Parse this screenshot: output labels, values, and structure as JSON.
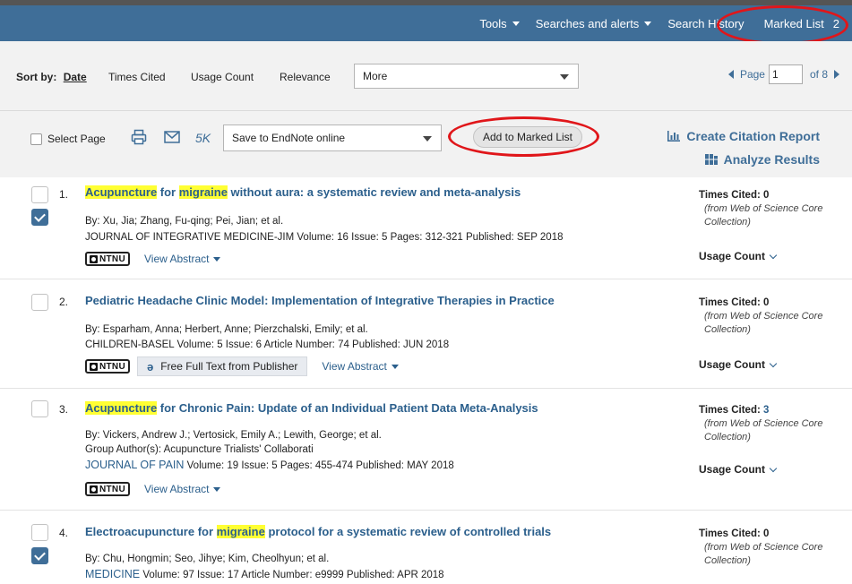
{
  "topnav": {
    "tools": "Tools",
    "searches": "Searches and alerts",
    "history": "Search History",
    "marked_list": "Marked List",
    "marked_count": "2"
  },
  "sort": {
    "label": "Sort by:",
    "active": "Date",
    "options": [
      "Times Cited",
      "Usage Count",
      "Relevance"
    ],
    "more": "More"
  },
  "pager": {
    "page_label": "Page",
    "page_value": "1",
    "of_label": "of 8"
  },
  "toolbar": {
    "select_page": "Select Page",
    "count_5k": "5K",
    "save_select": "Save to EndNote online",
    "add_marked": "Add to Marked List",
    "citation_report": "Create Citation Report",
    "analyze": "Analyze Results"
  },
  "labels": {
    "times_cited": "Times Cited:",
    "from_wos": "(from Web of Science Core Collection)",
    "usage_count": "Usage Count",
    "view_abstract": "View Abstract",
    "free_full_text": "Free Full Text from Publisher",
    "ntnu": "NTNU"
  },
  "records": [
    {
      "num": "1.",
      "title_parts": [
        "Acupuncture",
        " for ",
        "migraine",
        " without aura: a systematic review and meta-analysis"
      ],
      "authors": "By: Xu, Jia; Zhang, Fu-qing; Pei, Jian; et al.",
      "journal": "JOURNAL OF INTEGRATIVE MEDICINE-JIM  Volume: 16  Issue: 5  Pages: 312-321  Published: SEP 2018",
      "cited": "0"
    },
    {
      "num": "2.",
      "title": "Pediatric Headache Clinic Model: Implementation of Integrative Therapies in Practice",
      "authors": "By: Esparham, Anna; Herbert, Anne; Pierzchalski, Emily; et al.",
      "journal": "CHILDREN-BASEL  Volume: 5  Issue: 6  Article Number: 74  Published: JUN 2018",
      "cited": "0"
    },
    {
      "num": "3.",
      "title_parts": [
        "Acupuncture",
        " for Chronic Pain: Update of an Individual Patient Data Meta-Analysis"
      ],
      "authors": "By: Vickers, Andrew J.; Vertosick, Emily A.; Lewith, George; et al.",
      "group": "Group Author(s): Acupuncture Trialists' Collaborati",
      "journal_name": "JOURNAL OF PAIN",
      "journal_rest": "  Volume: 19  Issue: 5  Pages: 455-474  Published: MAY 2018",
      "cited": "3"
    },
    {
      "num": "4.",
      "title_parts": [
        "Electroacupuncture for ",
        "migraine",
        " protocol for a systematic review of controlled trials"
      ],
      "authors": "By: Chu, Hongmin; Seo, Jihye; Kim, Cheolhyun; et al.",
      "journal_name": "MEDICINE",
      "journal_rest": "  Volume: 97  Issue: 17  Article Number: e9999  Published: APR 2018",
      "cited": "0"
    }
  ]
}
